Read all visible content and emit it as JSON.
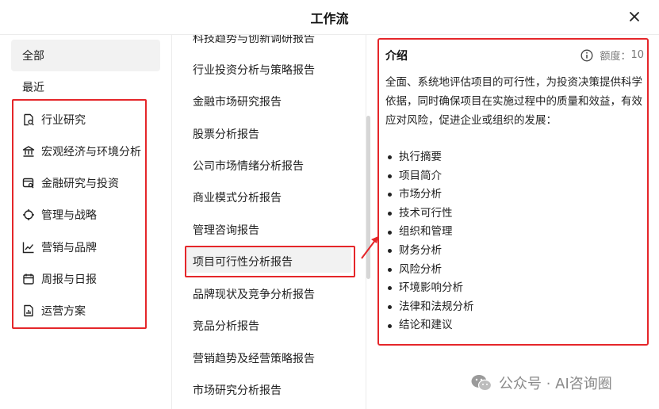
{
  "header": {
    "title": "工作流"
  },
  "sidebar": {
    "items": [
      {
        "label": "全部",
        "icon": null,
        "active": true
      },
      {
        "label": "最近",
        "icon": null,
        "active": false
      },
      {
        "label": "行业研究",
        "icon": "doc-search-icon",
        "active": false
      },
      {
        "label": "宏观经济与环境分析",
        "icon": "bank-icon",
        "active": false
      },
      {
        "label": "金融研究与投资",
        "icon": "wallet-search-icon",
        "active": false
      },
      {
        "label": "管理与战略",
        "icon": "crosshair-icon",
        "active": false
      },
      {
        "label": "营销与品牌",
        "icon": "trend-chart-icon",
        "active": false
      },
      {
        "label": "周报与日报",
        "icon": "calendar-icon",
        "active": false
      },
      {
        "label": "运营方案",
        "icon": "report-chart-icon",
        "active": false
      }
    ]
  },
  "workflows": {
    "items": [
      "科技趋势与创新调研报告",
      "行业投资分析与策略报告",
      "金融市场研究报告",
      "股票分析报告",
      "公司市场情绪分析报告",
      "商业模式分析报告",
      "管理咨询报告",
      "项目可行性分析报告",
      "品牌现状及竞争分析报告",
      "竞品分析报告",
      "营销趋势及经营策略报告",
      "市场研究分析报告"
    ],
    "selected_index": 7
  },
  "detail": {
    "title": "介绍",
    "quota_label": "额度：",
    "quota_value": "10",
    "description": "全面、系统地评估项目的可行性，为投资决策提供科学依据，同时确保项目在实施过程中的质量和效益，有效应对风险，促进企业或组织的发展：",
    "bullets": [
      "执行摘要",
      "项目简介",
      "市场分析",
      "技术可行性",
      "组织和管理",
      "财务分析",
      "风险分析",
      "环境影响分析",
      "法律和法规分析",
      "结论和建议"
    ]
  },
  "watermark": {
    "text": "公众号 · AI咨询圈"
  },
  "colors": {
    "annotation_red": "#e5262a",
    "selected_bg": "#f2f2f2"
  }
}
